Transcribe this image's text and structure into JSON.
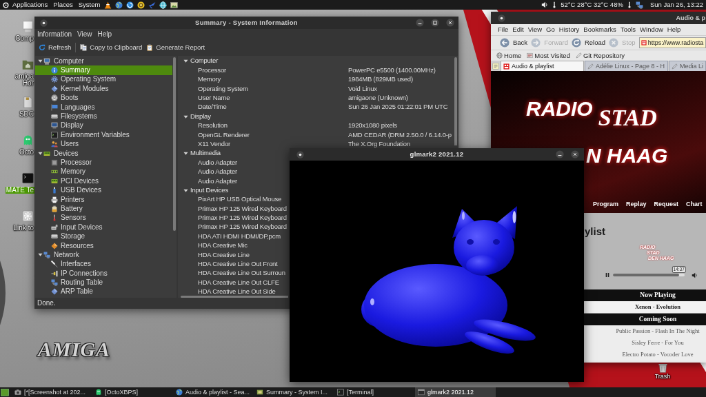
{
  "top_panel": {
    "menus": [
      {
        "label": "Applications",
        "kind": "applications"
      },
      {
        "label": "Places",
        "kind": "plain"
      },
      {
        "label": "System",
        "kind": "plain"
      }
    ],
    "sensors": "52°C 28°C 32°C 48%",
    "clock": "Sun Jan 26, 13:22"
  },
  "desktop": {
    "icons": [
      {
        "kind": "computer",
        "lines": [
          "Comp"
        ],
        "selected": false
      },
      {
        "kind": "home",
        "lines": [
          "amiga",
          "Hor"
        ],
        "selected": false
      },
      {
        "kind": "drive",
        "lines": [
          "SDC"
        ],
        "selected": false
      },
      {
        "kind": "ghost",
        "lines": [
          "Octo"
        ],
        "selected": false
      },
      {
        "kind": "terminal",
        "lines": [
          "MATE Te"
        ],
        "selected": true
      },
      {
        "kind": "link",
        "lines": [
          "Link to"
        ],
        "selected": false
      }
    ],
    "logo": "AMIGA",
    "trash": "Trash"
  },
  "system_info": {
    "title": "Summary - System Information",
    "menu": [
      "Information",
      "View",
      "Help"
    ],
    "toolbar": [
      {
        "label": "Refresh",
        "kind": "refresh"
      },
      {
        "label": "Copy to Clipboard",
        "kind": "copy"
      },
      {
        "label": "Generate Report",
        "kind": "report"
      }
    ],
    "tree": [
      {
        "label": "Computer",
        "kind": "computer",
        "expanded": true,
        "selected": false,
        "children": [
          {
            "label": "Summary",
            "kind": "info",
            "selected": true
          },
          {
            "label": "Operating System",
            "kind": "gear",
            "selected": false
          },
          {
            "label": "Kernel Modules",
            "kind": "module",
            "selected": false
          },
          {
            "label": "Boots",
            "kind": "power",
            "selected": false
          },
          {
            "label": "Languages",
            "kind": "flag",
            "selected": false
          },
          {
            "label": "Filesystems",
            "kind": "drive",
            "selected": false
          },
          {
            "label": "Display",
            "kind": "monitor",
            "selected": false
          },
          {
            "label": "Environment Variables",
            "kind": "terminal",
            "selected": false
          },
          {
            "label": "Users",
            "kind": "users",
            "selected": false
          }
        ]
      },
      {
        "label": "Devices",
        "kind": "board",
        "expanded": true,
        "selected": false,
        "children": [
          {
            "label": "Processor",
            "kind": "chip",
            "selected": false
          },
          {
            "label": "Memory",
            "kind": "memory",
            "selected": false
          },
          {
            "label": "PCI Devices",
            "kind": "board",
            "selected": false
          },
          {
            "label": "USB Devices",
            "kind": "usb",
            "selected": false
          },
          {
            "label": "Printers",
            "kind": "printer",
            "selected": false
          },
          {
            "label": "Battery",
            "kind": "battery",
            "selected": false
          },
          {
            "label": "Sensors",
            "kind": "thermometer",
            "selected": false
          },
          {
            "label": "Input Devices",
            "kind": "input",
            "selected": false
          },
          {
            "label": "Storage",
            "kind": "drive",
            "selected": false
          },
          {
            "label": "Resources",
            "kind": "resource",
            "selected": false
          }
        ]
      },
      {
        "label": "Network",
        "kind": "network",
        "expanded": true,
        "selected": false,
        "children": [
          {
            "label": "Interfaces",
            "kind": "cable",
            "selected": false
          },
          {
            "label": "IP Connections",
            "kind": "plug",
            "selected": false
          },
          {
            "label": "Routing Table",
            "kind": "network",
            "selected": false
          },
          {
            "label": "ARP Table",
            "kind": "module",
            "selected": false
          }
        ]
      }
    ],
    "details": [
      {
        "label": "Computer",
        "expanded": true,
        "rows": [
          {
            "key": "Processor",
            "value": "PowerPC e5500 (1400.00MHz)"
          },
          {
            "key": "Memory",
            "value": "1984MB (829MB used)"
          },
          {
            "key": "Operating System",
            "value": "Void Linux"
          },
          {
            "key": "User Name",
            "value": "amigaone (Unknown)"
          },
          {
            "key": "Date/Time",
            "value": "Sun 26 Jan 2025 01:22:01 PM UTC"
          }
        ]
      },
      {
        "label": "Display",
        "expanded": true,
        "rows": [
          {
            "key": "Resolution",
            "value": "1920x1080 pixels"
          },
          {
            "key": "OpenGL Renderer",
            "value": "AMD CEDAR (DRM 2.50.0 / 6.14.0-p"
          },
          {
            "key": "X11 Vendor",
            "value": "The X.Org Foundation"
          }
        ]
      },
      {
        "label": "Multimedia",
        "expanded": true,
        "rows": [
          {
            "key": "Audio Adapter"
          },
          {
            "key": "Audio Adapter"
          },
          {
            "key": "Audio Adapter"
          }
        ]
      },
      {
        "label": "Input Devices",
        "expanded": true,
        "rows": [
          {
            "key": "PixArt HP USB Optical Mouse"
          },
          {
            "key": "Primax HP 125 Wired Keyboard"
          },
          {
            "key": "Primax HP 125 Wired Keyboard"
          },
          {
            "key": "Primax HP 125 Wired Keyboard"
          },
          {
            "key": "HDA ATI HDMI HDMI/DP,pcm"
          },
          {
            "key": "HDA Creative Mic"
          },
          {
            "key": "HDA Creative Line"
          },
          {
            "key": "HDA Creative Line Out Front"
          },
          {
            "key": "HDA Creative Line Out Surroun"
          },
          {
            "key": "HDA Creative Line Out CLFE"
          },
          {
            "key": "HDA Creative Line Out Side"
          }
        ]
      }
    ],
    "status": "Done."
  },
  "glmark": {
    "title": "glmark2 2021.12"
  },
  "browser": {
    "title": "Audio & p",
    "menu": [
      "File",
      "Edit",
      "View",
      "Go",
      "History",
      "Bookmarks",
      "Tools",
      "Window",
      "Help"
    ],
    "nav": [
      {
        "label": "Back",
        "kind": "back",
        "disabled": false
      },
      {
        "label": "Forward",
        "kind": "forward",
        "disabled": true
      },
      {
        "label": "Reload",
        "kind": "reload",
        "disabled": false
      },
      {
        "label": "Stop",
        "kind": "stop",
        "disabled": true
      }
    ],
    "url": "https://www.radiosta",
    "bookmarks": [
      {
        "label": "Home",
        "kind": "home"
      },
      {
        "label": "Most Visited",
        "kind": "folder"
      },
      {
        "label": "Git Repository",
        "kind": "page"
      }
    ],
    "tabs": [
      {
        "label": "Audio & playlist",
        "kind": "site",
        "selected": true
      },
      {
        "label": "Adélie Linux - Page 8 - H",
        "kind": "page",
        "selected": false
      },
      {
        "label": "Media Li",
        "kind": "page",
        "selected": false
      }
    ],
    "page": {
      "logo": [
        "RADIO",
        "STAD",
        "N HAAG"
      ],
      "nav": [
        "Program",
        "Replay",
        "Request",
        "Chart"
      ],
      "heading": "ylist",
      "player_logo": [
        "RADIO",
        "STAD",
        "DEN HAAG"
      ],
      "player": {
        "playing": true,
        "level": 0.92,
        "time": "14:37"
      },
      "playlist": [
        {
          "kind": "header",
          "text": "Now Playing"
        },
        {
          "kind": "current",
          "text": "Xenon - Evolution"
        },
        {
          "kind": "header",
          "text": "Coming Soon"
        },
        {
          "kind": "track",
          "text": "Public Passion - Flash In The Night"
        },
        {
          "kind": "track",
          "text": "Sisley Ferre - For You"
        },
        {
          "kind": "track",
          "text": "Electro Potato - Vocoder Love"
        }
      ]
    }
  },
  "taskbar": {
    "items": [
      {
        "label": "[*[Screenshot at 202...",
        "kind": "camera",
        "selected": false
      },
      {
        "label": "[OctoXBPS]",
        "kind": "ghost",
        "selected": false
      },
      {
        "label": "Audio & playlist - Sea...",
        "kind": "web",
        "selected": false
      },
      {
        "label": "Summary - System I...",
        "kind": "sysinfo",
        "selected": false
      },
      {
        "label": "[Terminal]",
        "kind": "terminal",
        "selected": false
      },
      {
        "label": "glmark2 2021.12",
        "kind": "window",
        "selected": true
      }
    ]
  }
}
